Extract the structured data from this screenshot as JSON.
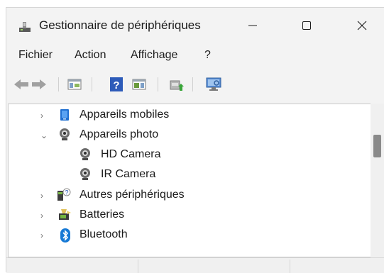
{
  "window": {
    "title": "Gestionnaire de périphériques"
  },
  "menu": {
    "items": [
      "Fichier",
      "Action",
      "Affichage",
      "?"
    ]
  },
  "toolbar": {
    "buttons": [
      "back-arrow-icon",
      "forward-arrow-icon",
      "properties-icon",
      "help-icon",
      "show-hidden-icon",
      "update-driver-icon",
      "scan-hardware-icon"
    ]
  },
  "tree": {
    "rows": [
      {
        "label": "Appareils mobiles",
        "expanded": false,
        "level": 0,
        "icon": "mobile-device-icon"
      },
      {
        "label": "Appareils photo",
        "expanded": true,
        "level": 0,
        "icon": "webcam-icon"
      },
      {
        "label": "HD Camera",
        "level": 1,
        "icon": "webcam-icon"
      },
      {
        "label": "IR Camera",
        "level": 1,
        "icon": "webcam-icon"
      },
      {
        "label": "Autres périphériques",
        "expanded": false,
        "level": 0,
        "icon": "unknown-device-icon"
      },
      {
        "label": "Batteries",
        "expanded": false,
        "level": 0,
        "icon": "battery-icon"
      },
      {
        "label": "Bluetooth",
        "expanded": false,
        "level": 0,
        "icon": "bluetooth-icon"
      }
    ]
  },
  "colors": {
    "accent": "#0078d4",
    "bluetooth": "#1679d5",
    "window_bg": "#f3f3f3"
  }
}
